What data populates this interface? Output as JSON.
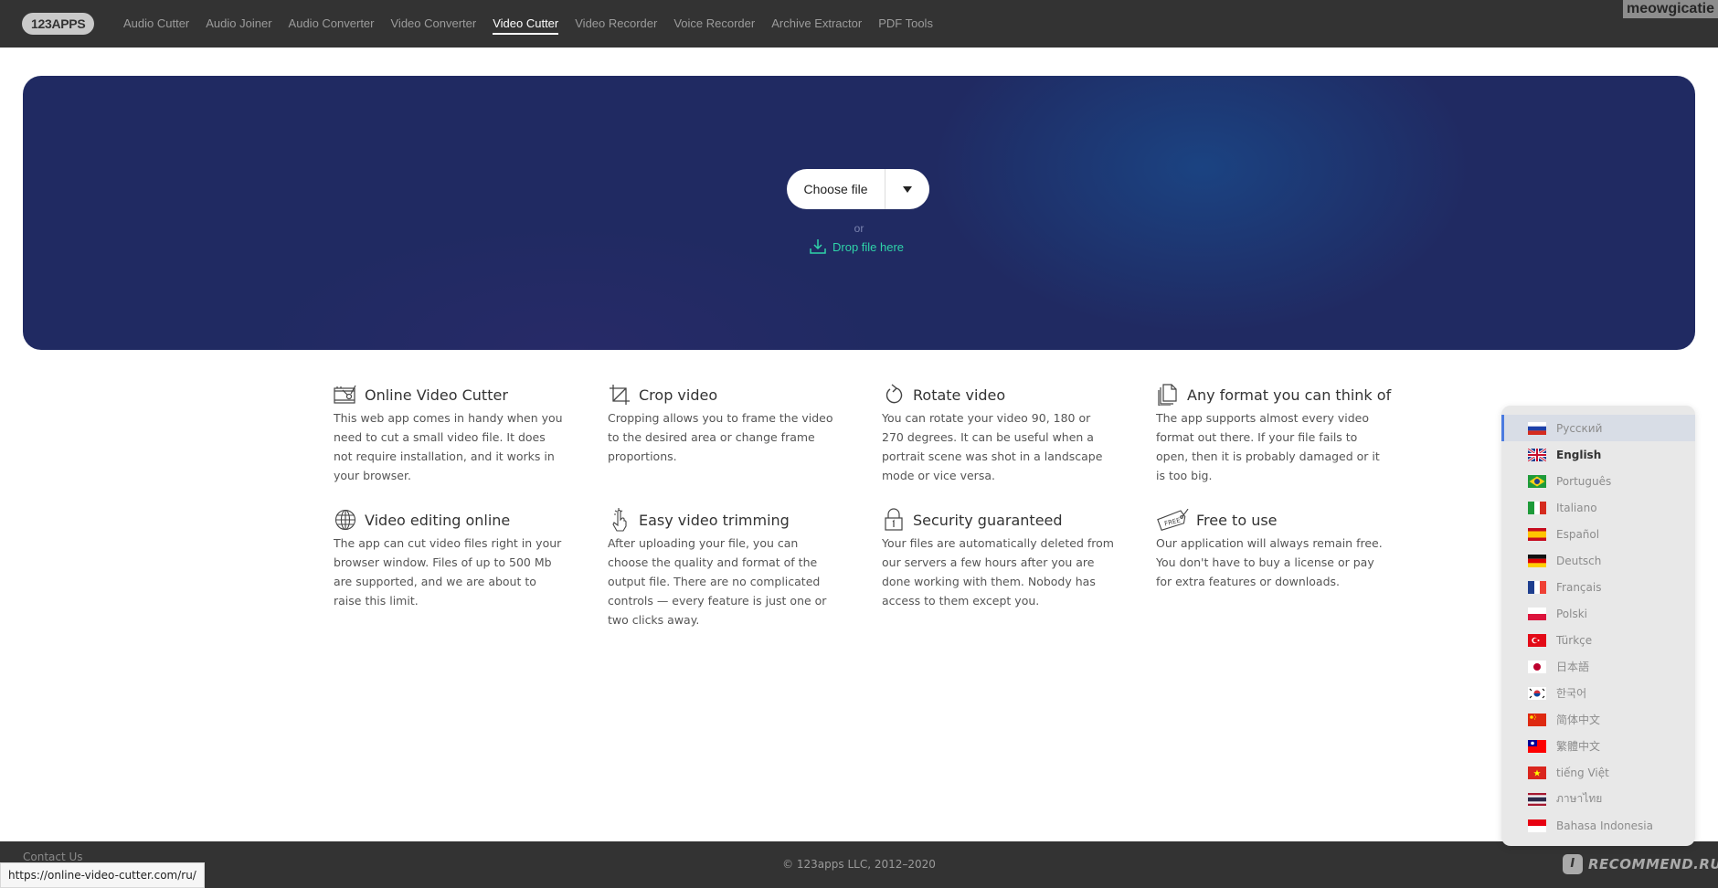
{
  "header": {
    "logo": "123APPS",
    "nav": [
      {
        "label": "Audio Cutter",
        "active": false
      },
      {
        "label": "Audio Joiner",
        "active": false
      },
      {
        "label": "Audio Converter",
        "active": false
      },
      {
        "label": "Video Converter",
        "active": false
      },
      {
        "label": "Video Cutter",
        "active": true
      },
      {
        "label": "Video Recorder",
        "active": false
      },
      {
        "label": "Voice Recorder",
        "active": false
      },
      {
        "label": "Archive Extractor",
        "active": false
      },
      {
        "label": "PDF Tools",
        "active": false
      }
    ],
    "user_badge": "meowgicatie"
  },
  "hero": {
    "choose_file_label": "Choose file",
    "or_label": "or",
    "drop_label": "Drop file here",
    "accent_color": "#2fd3a8",
    "background_color": "#202a62"
  },
  "features": [
    {
      "icon": "film-scissors-icon",
      "title": "Online Video Cutter",
      "text": "This web app comes in handy when you need to cut a small video file. It does not require installation, and it works in your browser."
    },
    {
      "icon": "crop-icon",
      "title": "Crop video",
      "text": "Cropping allows you to frame the video to the desired area or change frame proportions."
    },
    {
      "icon": "rotate-icon",
      "title": "Rotate video",
      "text": "You can rotate your video 90, 180 or 270 degrees. It can be useful when a portrait scene was shot in a landscape mode or vice versa."
    },
    {
      "icon": "files-icon",
      "title": "Any format you can think of",
      "text": "The app supports almost every video format out there. If your file fails to open, then it is probably damaged or it is too big."
    },
    {
      "icon": "globe-icon",
      "title": "Video editing online",
      "text": "The app can cut video files right in your browser window. Files of up to 500 Mb are supported, and we are about to raise this limit."
    },
    {
      "icon": "tap-icon",
      "title": "Easy video trimming",
      "text": "After uploading your file, you can choose the quality and format of the output file. There are no complicated controls — every feature is just one or two clicks away."
    },
    {
      "icon": "lock-icon",
      "title": "Security guaranteed",
      "text": "Your files are automatically deleted from our servers a few hours after you are done working with them. Nobody has access to them except you."
    },
    {
      "icon": "free-tag-icon",
      "title": "Free to use",
      "text": "Our application will always remain free. You don't have to buy a license or pay for extra features or downloads."
    }
  ],
  "languages": [
    {
      "label": "Русский",
      "flag": "ru",
      "hover": true,
      "current": false
    },
    {
      "label": "English",
      "flag": "gb",
      "hover": false,
      "current": true
    },
    {
      "label": "Português",
      "flag": "br",
      "hover": false,
      "current": false
    },
    {
      "label": "Italiano",
      "flag": "it",
      "hover": false,
      "current": false
    },
    {
      "label": "Español",
      "flag": "es",
      "hover": false,
      "current": false
    },
    {
      "label": "Deutsch",
      "flag": "de",
      "hover": false,
      "current": false
    },
    {
      "label": "Français",
      "flag": "fr",
      "hover": false,
      "current": false
    },
    {
      "label": "Polski",
      "flag": "pl",
      "hover": false,
      "current": false
    },
    {
      "label": "Türkçe",
      "flag": "tr",
      "hover": false,
      "current": false
    },
    {
      "label": "日本語",
      "flag": "jp",
      "hover": false,
      "current": false
    },
    {
      "label": "한국어",
      "flag": "kr",
      "hover": false,
      "current": false
    },
    {
      "label": "简体中文",
      "flag": "cn",
      "hover": false,
      "current": false
    },
    {
      "label": "繁體中文",
      "flag": "tw",
      "hover": false,
      "current": false
    },
    {
      "label": "tiếng Việt",
      "flag": "vn",
      "hover": false,
      "current": false
    },
    {
      "label": "ภาษาไทย",
      "flag": "th",
      "hover": false,
      "current": false
    },
    {
      "label": "Bahasa Indonesia",
      "flag": "id",
      "hover": false,
      "current": false
    }
  ],
  "footer": {
    "contact_label": "Contact Us",
    "copyright": "© 123apps LLC, 2012–2020",
    "watermark": "RECOMMEND.RU"
  },
  "status_bar": {
    "url": "https://online-video-cutter.com/ru/"
  }
}
